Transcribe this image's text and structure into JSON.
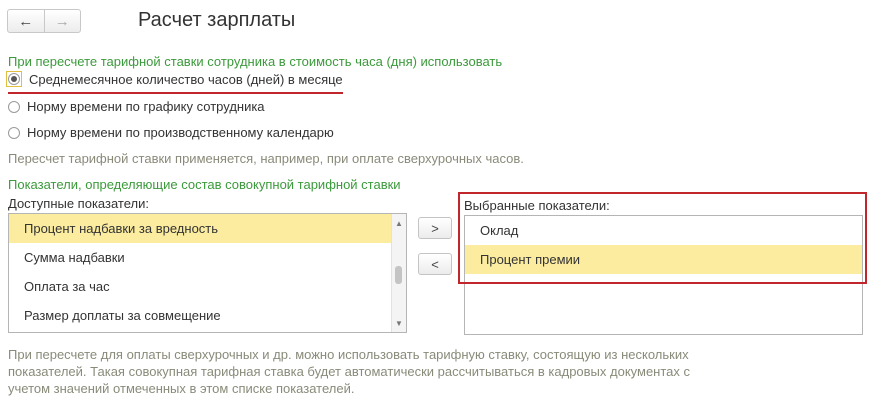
{
  "nav": {
    "back_icon": "←",
    "forward_icon": "→"
  },
  "page": {
    "title": "Расчет зарплаты"
  },
  "hour_cost_section": {
    "heading": "При пересчете тарифной ставки сотрудника в стоимость часа (дня) использовать",
    "options": [
      {
        "label": "Среднемесячное количество часов (дней) в месяце",
        "selected": true
      },
      {
        "label": "Норму времени по графику сотрудника",
        "selected": false
      },
      {
        "label": "Норму времени по производственному календарю",
        "selected": false
      }
    ],
    "hint": "Пересчет тарифной ставки применяется, например, при оплате сверхурочных часов."
  },
  "indicators_section": {
    "heading": "Показатели, определяющие состав совокупной тарифной ставки",
    "available_label": "Доступные показатели:",
    "available_items": [
      {
        "label": "Процент надбавки за вредность",
        "selected": true
      },
      {
        "label": "Сумма надбавки",
        "selected": false
      },
      {
        "label": "Оплата за час",
        "selected": false
      },
      {
        "label": "Размер доплаты за совмещение",
        "selected": false
      }
    ],
    "add_button": ">",
    "remove_button": "<",
    "selected_label": "Выбранные показатели:",
    "selected_items": [
      {
        "label": "Оклад",
        "selected": false
      },
      {
        "label": "Процент премии",
        "selected": true
      }
    ],
    "footer_hint_lines": [
      "При пересчете для оплаты сверхурочных и др. можно использовать тарифную ставку, состоящую из нескольких",
      "показателей. Такая совокупная тарифная ставка будет автоматически рассчитываться в кадровых документах с",
      "учетом значений отмеченных в этом списке показателей."
    ]
  },
  "colors": {
    "highlight": "#c0262c",
    "selection": "#fbeca0",
    "heading_green": "#3b9a3b"
  }
}
